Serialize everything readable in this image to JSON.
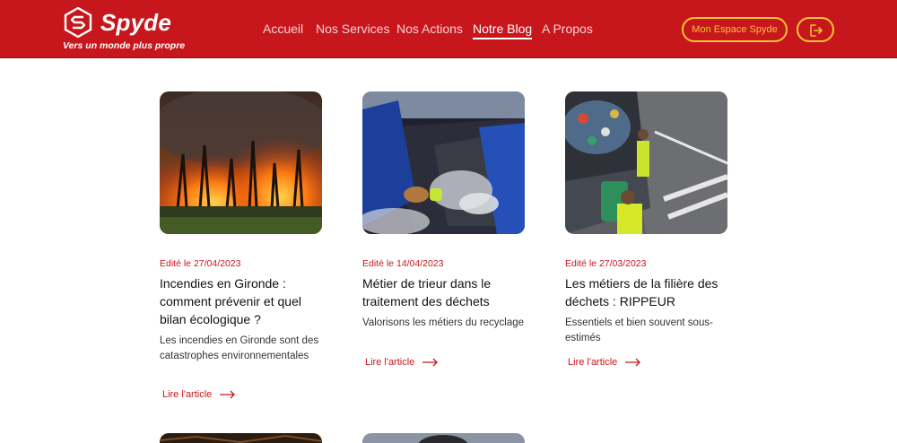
{
  "brand": {
    "name": "Spyde",
    "tagline": "Vers un monde plus propre",
    "colors": {
      "primary": "#c8161d",
      "accent": "#f6c531",
      "text": "#111111"
    }
  },
  "nav": {
    "items": [
      {
        "label": "Accueil",
        "active": false
      },
      {
        "label": "Nos Services",
        "active": false
      },
      {
        "label": "Nos Actions",
        "active": false
      },
      {
        "label": "Notre Blog",
        "active": true
      },
      {
        "label": "A Propos",
        "active": false
      }
    ]
  },
  "header_actions": {
    "space_label": "Mon Espace Spyde",
    "logout_icon": "logout-icon"
  },
  "articles": [
    {
      "date": "Edité le 27/04/2023",
      "title": "Incendies en Gironde : comment prévenir et quel bilan écologique ?",
      "excerpt": "Les incendies en Gironde sont des catastrophes environnementales",
      "link_label": "Lire l'article",
      "image": "forest-fire-photo"
    },
    {
      "date": "Edité le 14/04/2023",
      "title": "Métier de trieur dans le traitement des déchets",
      "excerpt": "Valorisons les métiers du recyclage",
      "link_label": "Lire l'article",
      "image": "waste-sorting-photo"
    },
    {
      "date": "Edité le 27/03/2023",
      "title": "Les métiers de la filière des déchets : RIPPEUR",
      "excerpt": "Essentiels et bien souvent sous-estimés",
      "link_label": "Lire l'article",
      "image": "garbage-truck-photo"
    }
  ]
}
